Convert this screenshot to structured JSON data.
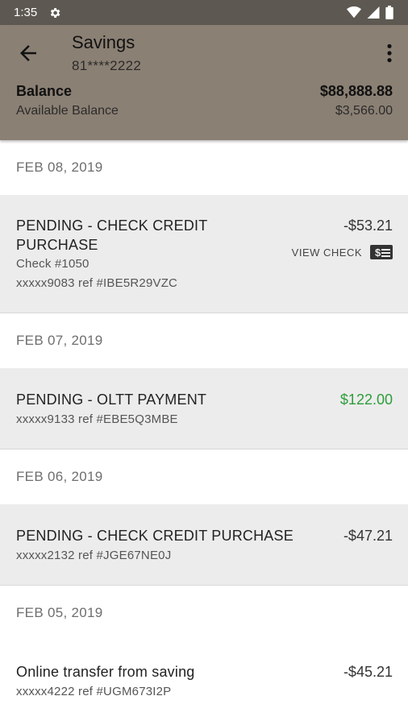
{
  "status_bar": {
    "time": "1:35",
    "icons": [
      "gear-icon",
      "wifi-icon",
      "signal-icon",
      "battery-icon"
    ]
  },
  "header": {
    "title": "Savings",
    "account_number": "81****2222",
    "balance_label": "Balance",
    "balance_value": "$88,888.88",
    "available_label": "Available Balance",
    "available_value": "$3,566.00"
  },
  "sections": [
    {
      "date": "FEB 08, 2019",
      "transactions": [
        {
          "description": "PENDING - CHECK CREDIT PURCHASE",
          "detail": "Check #1050",
          "ref": "xxxxx9083 ref #IBE5R29VZC",
          "amount": "-$53.21",
          "action_label": "VIEW CHECK"
        }
      ]
    },
    {
      "date": "FEB 07, 2019",
      "transactions": [
        {
          "description": "PENDING - OLTT PAYMENT",
          "ref": "xxxxx9133 ref #EBE5Q3MBE",
          "amount": "$122.00"
        }
      ]
    },
    {
      "date": "FEB 06, 2019",
      "transactions": [
        {
          "description": "PENDING - CHECK CREDIT PURCHASE",
          "ref": "xxxxx2132 ref #JGE67NE0J",
          "amount": "-$47.21"
        }
      ]
    },
    {
      "date": "FEB 05, 2019",
      "transactions": [
        {
          "description": "Online transfer from saving",
          "ref": "xxxxx4222 ref #UGM673I2P",
          "amount": "-$45.21"
        }
      ]
    }
  ],
  "colors": {
    "appbar": "#8b8074",
    "statusbar": "#5d5851",
    "credit": "#2e9d3a",
    "row_bg": "#ececec"
  }
}
